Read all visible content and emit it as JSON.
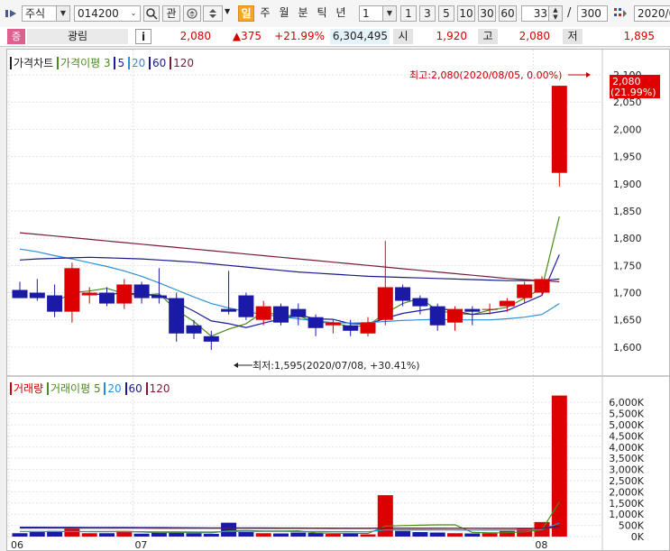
{
  "toolbar": {
    "market": "주식",
    "code": "014200",
    "btn_gwan": "관",
    "period_active": "일",
    "periods": [
      "주",
      "월",
      "분",
      "틱",
      "년"
    ],
    "interval_value": "1",
    "intervals": [
      "1",
      "3",
      "5",
      "10",
      "30",
      "60"
    ],
    "count_value": "33",
    "slash": "/",
    "total_value": "300",
    "date_value": "2020/0"
  },
  "info": {
    "badge": "증",
    "name": "광림",
    "info_button": "i",
    "price": "2,080",
    "change": "▲375",
    "change_pct": "+21.99%",
    "volume": "6,304,495",
    "open_label": "시",
    "open": "1,920",
    "high_label": "고",
    "high": "2,080",
    "low_label": "저",
    "low": "1,895"
  },
  "colors": {
    "up": "#dd0000",
    "down": "#1a1aa6",
    "ma3": "#4a8a1c",
    "ma5": "#1a1aa6",
    "ma20": "#2b8fd6",
    "ma60": "#1a1a8c",
    "ma120": "#7a1a3a"
  },
  "legend": {
    "price_chart": "가격차트",
    "price_ma": "가격이평",
    "price_periods": [
      "3",
      "5",
      "20",
      "60",
      "120"
    ],
    "volume_chart": "거래량",
    "volume_ma": "거래이평",
    "volume_periods": [
      "5",
      "20",
      "60",
      "120"
    ]
  },
  "annotations": {
    "high": "최고:2,080(2020/08/05, 0.00%)",
    "low": "최저:1,595(2020/07/08, +30.41%)",
    "last_price": "2,080",
    "last_pct": "(21.99%)"
  },
  "chart_data": [
    {
      "type": "candlestick",
      "title": "가격차트",
      "y_ticks": [
        "2,100",
        "2,050",
        "2,000",
        "1,950",
        "1,900",
        "1,850",
        "1,800",
        "1,750",
        "1,700",
        "1,650",
        "1,600"
      ],
      "ylim": [
        1570,
        2110
      ],
      "x_ticks": [
        {
          "label": "06",
          "index": 0
        },
        {
          "label": "07",
          "index": 7
        },
        {
          "label": "08",
          "index": 30
        }
      ],
      "candles": [
        {
          "o": 1705,
          "h": 1720,
          "l": 1690,
          "c": 1690
        },
        {
          "o": 1700,
          "h": 1725,
          "l": 1685,
          "c": 1690
        },
        {
          "o": 1695,
          "h": 1715,
          "l": 1655,
          "c": 1665
        },
        {
          "o": 1665,
          "h": 1755,
          "l": 1645,
          "c": 1745
        },
        {
          "o": 1695,
          "h": 1710,
          "l": 1680,
          "c": 1700
        },
        {
          "o": 1700,
          "h": 1710,
          "l": 1675,
          "c": 1680
        },
        {
          "o": 1680,
          "h": 1725,
          "l": 1670,
          "c": 1715
        },
        {
          "o": 1715,
          "h": 1720,
          "l": 1680,
          "c": 1690
        },
        {
          "o": 1695,
          "h": 1745,
          "l": 1680,
          "c": 1690
        },
        {
          "o": 1690,
          "h": 1700,
          "l": 1610,
          "c": 1625
        },
        {
          "o": 1640,
          "h": 1650,
          "l": 1615,
          "c": 1625
        },
        {
          "o": 1620,
          "h": 1630,
          "l": 1595,
          "c": 1610
        },
        {
          "o": 1670,
          "h": 1740,
          "l": 1660,
          "c": 1665
        },
        {
          "o": 1695,
          "h": 1700,
          "l": 1650,
          "c": 1655
        },
        {
          "o": 1650,
          "h": 1685,
          "l": 1640,
          "c": 1675
        },
        {
          "o": 1675,
          "h": 1680,
          "l": 1640,
          "c": 1645
        },
        {
          "o": 1670,
          "h": 1680,
          "l": 1640,
          "c": 1655
        },
        {
          "o": 1655,
          "h": 1660,
          "l": 1620,
          "c": 1635
        },
        {
          "o": 1640,
          "h": 1650,
          "l": 1625,
          "c": 1645
        },
        {
          "o": 1640,
          "h": 1650,
          "l": 1620,
          "c": 1630
        },
        {
          "o": 1625,
          "h": 1655,
          "l": 1620,
          "c": 1645
        },
        {
          "o": 1650,
          "h": 1795,
          "l": 1640,
          "c": 1710
        },
        {
          "o": 1710,
          "h": 1715,
          "l": 1675,
          "c": 1685
        },
        {
          "o": 1690,
          "h": 1695,
          "l": 1660,
          "c": 1675
        },
        {
          "o": 1675,
          "h": 1680,
          "l": 1630,
          "c": 1640
        },
        {
          "o": 1645,
          "h": 1675,
          "l": 1630,
          "c": 1670
        },
        {
          "o": 1670,
          "h": 1675,
          "l": 1640,
          "c": 1665
        },
        {
          "o": 1670,
          "h": 1680,
          "l": 1660,
          "c": 1670
        },
        {
          "o": 1675,
          "h": 1690,
          "l": 1665,
          "c": 1685
        },
        {
          "o": 1690,
          "h": 1720,
          "l": 1680,
          "c": 1715
        },
        {
          "o": 1700,
          "h": 1730,
          "l": 1695,
          "c": 1725
        },
        {
          "o": 1920,
          "h": 2080,
          "l": 1895,
          "c": 2080
        }
      ],
      "ma": [
        {
          "name": "3",
          "color": "#4a8a1c",
          "values": [
            null,
            null,
            1682,
            1700,
            1703,
            1708,
            1698,
            1695,
            1698,
            1668,
            1647,
            1620,
            1633,
            1643,
            1665,
            1658,
            1658,
            1645,
            1645,
            1637,
            1640,
            1662,
            1680,
            1690,
            1667,
            1662,
            1660,
            1668,
            1673,
            1690,
            1708,
            1840
          ]
        },
        {
          "name": "5",
          "color": "#1a1aa6",
          "values": [
            null,
            null,
            null,
            null,
            1698,
            1696,
            1700,
            1696,
            1695,
            1682,
            1666,
            1648,
            1643,
            1636,
            1644,
            1652,
            1659,
            1652,
            1651,
            1643,
            1642,
            1653,
            1662,
            1667,
            1672,
            1666,
            1660,
            1662,
            1667,
            1681,
            1695,
            1770
          ]
        },
        {
          "name": "20",
          "color": "#2b8fd6",
          "values": [
            1780,
            1775,
            1768,
            1762,
            1755,
            1748,
            1740,
            1730,
            1718,
            1705,
            1692,
            1680,
            1672,
            1665,
            1660,
            1656,
            1652,
            1648,
            1645,
            1644,
            1645,
            1647,
            1649,
            1650,
            1651,
            1650,
            1650,
            1650,
            1652,
            1655,
            1660,
            1680
          ]
        },
        {
          "name": "60",
          "color": "#1a1a8c",
          "values": [
            1760,
            1762,
            1763,
            1764,
            1765,
            1764,
            1763,
            1762,
            1760,
            1758,
            1756,
            1753,
            1750,
            1747,
            1744,
            1741,
            1738,
            1736,
            1734,
            1732,
            1730,
            1729,
            1728,
            1727,
            1726,
            1725,
            1724,
            1723,
            1722,
            1722,
            1722,
            1725
          ]
        },
        {
          "name": "120",
          "color": "#7a1a3a",
          "values": [
            1810,
            1807,
            1804,
            1801,
            1798,
            1795,
            1792,
            1789,
            1786,
            1783,
            1780,
            1777,
            1774,
            1771,
            1768,
            1765,
            1762,
            1759,
            1756,
            1753,
            1750,
            1747,
            1744,
            1741,
            1738,
            1735,
            1732,
            1729,
            1726,
            1724,
            1722,
            1720
          ]
        }
      ]
    },
    {
      "type": "bar",
      "title": "거래량",
      "y_ticks": [
        "6,000K",
        "5,500K",
        "5,000K",
        "4,500K",
        "4,000K",
        "3,500K",
        "3,000K",
        "2,500K",
        "2,000K",
        "1,500K",
        "1,000K",
        "500K",
        "0K"
      ],
      "ylim": [
        0,
        6450
      ],
      "volumes": [
        150,
        200,
        250,
        350,
        150,
        150,
        250,
        130,
        180,
        200,
        150,
        120,
        620,
        200,
        150,
        140,
        180,
        160,
        120,
        140,
        100,
        1850,
        250,
        200,
        180,
        150,
        140,
        150,
        250,
        350,
        650,
        6304
      ],
      "ma": [
        {
          "name": "5",
          "color": "#4a8a1c",
          "values": [
            null,
            null,
            null,
            null,
            220,
            220,
            230,
            206,
            172,
            182,
            182,
            166,
            260,
            274,
            248,
            246,
            260,
            166,
            150,
            148,
            140,
            462,
            492,
            508,
            526,
            526,
            184,
            168,
            174,
            208,
            308,
            1550
          ]
        },
        {
          "name": "20",
          "color": "#2b8fd6",
          "values": [
            230,
            228,
            226,
            224,
            222,
            220,
            218,
            216,
            214,
            212,
            210,
            208,
            230,
            232,
            230,
            228,
            226,
            224,
            222,
            220,
            215,
            300,
            300,
            298,
            296,
            294,
            292,
            290,
            292,
            296,
            310,
            600
          ]
        },
        {
          "name": "60",
          "color": "#1a1a8c",
          "values": [
            420,
            418,
            416,
            414,
            412,
            410,
            408,
            405,
            402,
            399,
            396,
            393,
            390,
            388,
            386,
            384,
            382,
            380,
            378,
            376,
            374,
            380,
            378,
            376,
            374,
            372,
            370,
            368,
            366,
            366,
            370,
            470
          ]
        },
        {
          "name": "120",
          "color": "#7a1a3a",
          "values": [
            380,
            379,
            378,
            377,
            376,
            375,
            374,
            373,
            372,
            371,
            370,
            369,
            370,
            369,
            368,
            367,
            366,
            365,
            364,
            363,
            362,
            370,
            369,
            368,
            367,
            366,
            365,
            364,
            364,
            364,
            366,
            420
          ]
        }
      ]
    }
  ]
}
